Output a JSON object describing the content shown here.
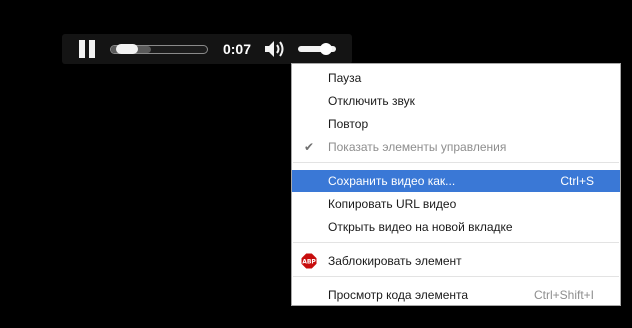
{
  "player": {
    "time": "0:07",
    "progress_fraction": 0.08,
    "buffered_fraction": 0.42,
    "volume_fraction": 0.85,
    "icons": [
      "pause-icon",
      "volume-icon"
    ]
  },
  "menu": {
    "items": [
      {
        "label": "Пауза"
      },
      {
        "label": "Отключить звук"
      },
      {
        "label": "Повтор"
      },
      {
        "label": "Показать элементы управления",
        "checked": true,
        "disabled": true
      },
      {
        "label": "Сохранить видео как...",
        "shortcut": "Ctrl+S",
        "highlighted": true
      },
      {
        "label": "Копировать URL видео"
      },
      {
        "label": "Открыть видео на новой вкладке"
      },
      {
        "label": "Заблокировать элемент",
        "icon": "adblock-icon"
      },
      {
        "label": "Просмотр кода элемента",
        "shortcut": "Ctrl+Shift+I"
      }
    ],
    "check_glyph": "✔",
    "adblock_text": "ABP"
  },
  "colors": {
    "highlight": "#3a78d6",
    "adblock_red": "#c70d0d"
  }
}
